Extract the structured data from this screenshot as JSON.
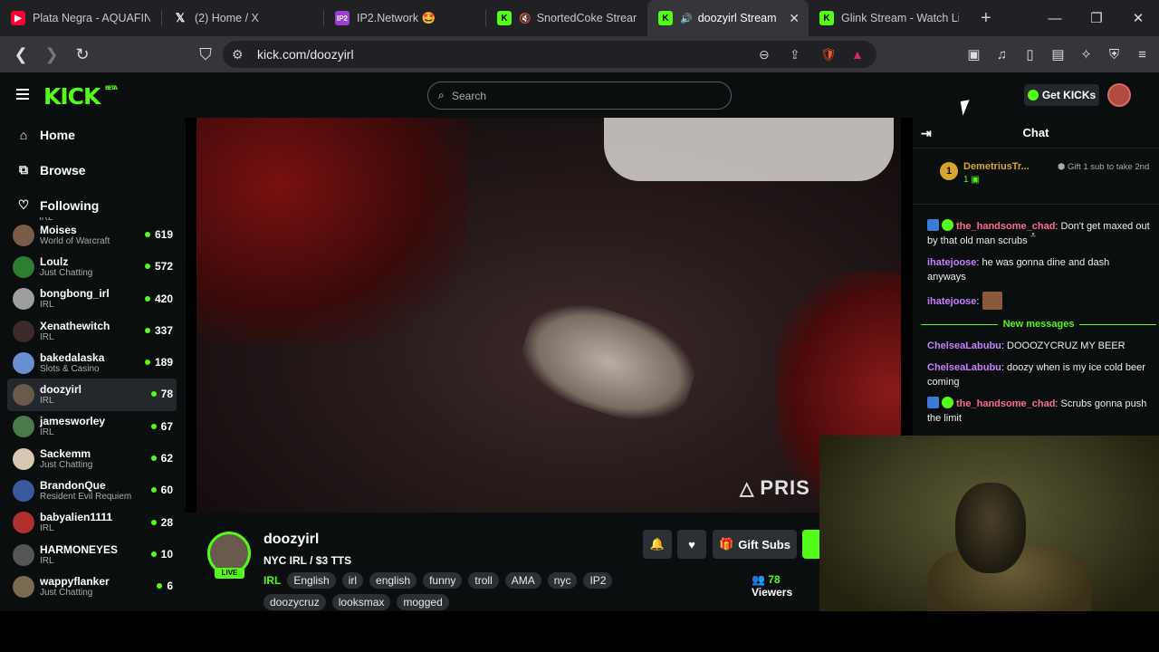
{
  "browser": {
    "tabs": [
      {
        "title": "Plata Negra - AQUAFINI",
        "icon": "youtube-icon",
        "color": "#ff0033"
      },
      {
        "title": "(2) Home / X",
        "icon": "x-icon",
        "color": "#ffffff"
      },
      {
        "title": "IP2.Network 🤩",
        "icon": "ip2-icon",
        "color": "#9b3fd6"
      },
      {
        "title": "SnortedCoke Stream",
        "icon": "kick-icon",
        "color": "#53fc18",
        "muted": true
      },
      {
        "title": "doozyirl Stream",
        "icon": "kick-icon",
        "color": "#53fc18",
        "active": true,
        "audio": true
      },
      {
        "title": "Glink Stream - Watch Li",
        "icon": "kick-icon",
        "color": "#53fc18"
      }
    ],
    "url": "kick.com/doozyirl"
  },
  "header": {
    "logo": "KICK",
    "logo_sup": "BETA",
    "search_placeholder": "Search",
    "get_kicks": "Get KICKs"
  },
  "sidebar": {
    "nav": [
      {
        "label": "Home",
        "icon": "home-icon"
      },
      {
        "label": "Browse",
        "icon": "browse-icon"
      },
      {
        "label": "Following",
        "icon": "heart-icon"
      }
    ],
    "partial_top_category": "IRL",
    "following": [
      {
        "name": "Moises",
        "category": "World of Warcraft",
        "viewers": "619",
        "color": "#7a5c48"
      },
      {
        "name": "Loulz",
        "category": "Just Chatting",
        "viewers": "572",
        "color": "#2e7d32"
      },
      {
        "name": "bongbong_irl",
        "category": "IRL",
        "viewers": "420",
        "color": "#9e9e9e"
      },
      {
        "name": "Xenathewitch",
        "category": "IRL",
        "viewers": "337",
        "color": "#3a2a2a"
      },
      {
        "name": "bakedalaska",
        "category": "Slots & Casino",
        "viewers": "189",
        "color": "#6a8fd0"
      },
      {
        "name": "doozyirl",
        "category": "IRL",
        "viewers": "78",
        "color": "#6a5a4c",
        "selected": true
      },
      {
        "name": "jamesworley",
        "category": "IRL",
        "viewers": "67",
        "color": "#4a7a4a"
      },
      {
        "name": "Sackemm",
        "category": "Just Chatting",
        "viewers": "62",
        "color": "#d8c8b0"
      },
      {
        "name": "BrandonQue",
        "category": "Resident Evil Requiem",
        "viewers": "60",
        "color": "#3a5aa0"
      },
      {
        "name": "babyalien1111",
        "category": "IRL",
        "viewers": "28",
        "color": "#b03030"
      },
      {
        "name": "HARMONEYES",
        "category": "IRL",
        "viewers": "10",
        "color": "#555555"
      },
      {
        "name": "wappyflanker",
        "category": "Just Chatting",
        "viewers": "6",
        "color": "#7a6a50"
      }
    ]
  },
  "video": {
    "watermark": "PRIS"
  },
  "channel": {
    "name": "doozyirl",
    "title": "NYC IRL / $3 TTS",
    "live_badge": "LIVE",
    "category": "IRL",
    "tags": [
      "English",
      "irl",
      "english",
      "funny",
      "troll",
      "AMA",
      "nyc",
      "IP2",
      "doozycruz",
      "looksmax",
      "mogged"
    ],
    "gift_subs": "Gift Subs",
    "viewers_count": "78",
    "viewers_label": "Viewers"
  },
  "chat": {
    "title": "Chat",
    "pinned": {
      "rank": "1",
      "name": "DemetriusTr...",
      "count": "1",
      "gift_text": "Gift 1 sub to take 2nd"
    },
    "messages_before": [
      {
        "user": "the_handsome_chad",
        "color": "#ff6b8a",
        "text": "Don't get maxed out by that old man scrubs",
        "badges": true
      },
      {
        "user": "ihatejoose",
        "color": "#c77dff",
        "text": "he was gonna dine and dash anyways",
        "badges": false
      },
      {
        "user": "ihatejoose",
        "color": "#c77dff",
        "text": "",
        "badges": false,
        "emote": true
      }
    ],
    "new_messages_label": "New messages",
    "messages_after": [
      {
        "user": "ChelseaLabubu",
        "color": "#c77dff",
        "text": "DOOOZYCRUZ MY BEER",
        "badges": false
      },
      {
        "user": "ChelseaLabubu",
        "color": "#c77dff",
        "text": "doozy when is my ice cold beer coming",
        "badges": false
      },
      {
        "user": "the_handsome_chad",
        "color": "#ff6b8a",
        "text": "Scrubs gonna push the limit",
        "badges": true
      }
    ]
  },
  "colors": {
    "accent": "#53fc18",
    "bg": "#0b0e0f"
  }
}
